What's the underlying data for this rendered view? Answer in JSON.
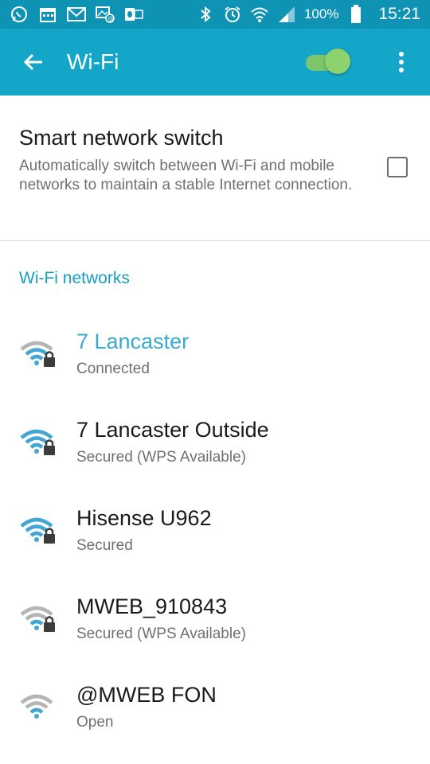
{
  "status_bar": {
    "icons": [
      "whatsapp-icon",
      "calendar-icon",
      "gmail-icon",
      "image-email-icon",
      "outlook-icon"
    ],
    "battery_text": "100%",
    "time": "15:21"
  },
  "app_bar": {
    "title": "Wi-Fi",
    "wifi_enabled": true
  },
  "smart_switch": {
    "title": "Smart network switch",
    "description": "Automatically switch between Wi-Fi and mobile networks to maintain a stable Internet connection.",
    "checked": false
  },
  "networks_header": "Wi-Fi networks",
  "networks": [
    {
      "name": "7 Lancaster",
      "status": "Connected",
      "connected": true,
      "secured": true
    },
    {
      "name": "7 Lancaster Outside",
      "status": "Secured (WPS Available)",
      "connected": false,
      "secured": true
    },
    {
      "name": "Hisense U962",
      "status": "Secured",
      "connected": false,
      "secured": true
    },
    {
      "name": "MWEB_910843",
      "status": "Secured (WPS Available)",
      "connected": false,
      "secured": true
    },
    {
      "name": "@MWEB FON",
      "status": "Open",
      "connected": false,
      "secured": false
    }
  ],
  "colors": {
    "status_bar": "#0f93b4",
    "app_bar": "#14a6c9",
    "accent": "#1a9cbf",
    "toggle_on": "#8ed16f"
  }
}
